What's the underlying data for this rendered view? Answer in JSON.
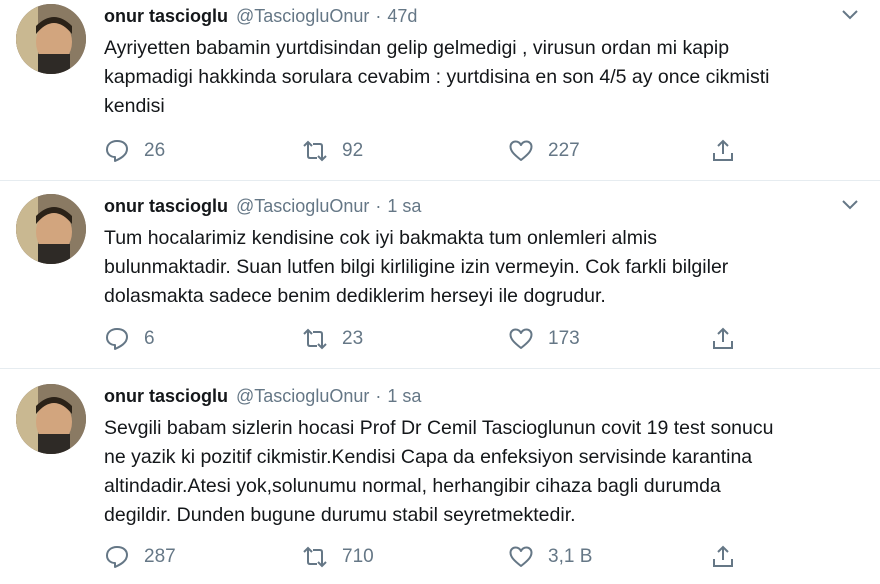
{
  "tweets": [
    {
      "name": "onur tascioglu",
      "handle": "@TasciogluOnur",
      "separator": "·",
      "time": "47d",
      "lines": [
        "Ayriyetten babamin yurtdisindan gelip gelmedigi , virusun ordan mi kapip",
        "kapmadigi hakkinda sorulara cevabim : yurtdisina en son 4/5 ay once cikmisti",
        "kendisi"
      ],
      "replies": "26",
      "retweets": "92",
      "likes": "227"
    },
    {
      "name": "onur tascioglu",
      "handle": "@TasciogluOnur",
      "separator": "·",
      "time": "1 sa",
      "lines": [
        "Tum hocalarimiz kendisine cok iyi bakmakta tum onlemleri almis",
        "bulunmaktadir. Suan lutfen bilgi kirliligine izin vermeyin. Cok farkli bilgiler",
        "dolasmakta sadece benim dediklerim herseyi ile dogrudur."
      ],
      "replies": "6",
      "retweets": "23",
      "likes": "173"
    },
    {
      "name": "onur tascioglu",
      "handle": "@TasciogluOnur",
      "separator": "·",
      "time": "1 sa",
      "lines": [
        "Sevgili babam sizlerin hocasi Prof Dr Cemil Tascioglunun covit 19 test sonucu",
        "ne yazik ki pozitif cikmistir.Kendisi Capa da enfeksiyon servisinde karantina",
        "altindadir.Atesi yok,solunumu normal, herhangibir cihaza bagli durumda",
        "degildir. Dunden bugune durumu stabil seyretmektedir."
      ],
      "replies": "287",
      "retweets": "710",
      "likes": "3,1 B"
    }
  ],
  "icons": {
    "reply": "reply-icon",
    "retweet": "retweet-icon",
    "like": "heart-icon",
    "share": "share-icon",
    "caret": "chevron-down-icon"
  },
  "colors": {
    "text": "#14171a",
    "secondary": "#657786",
    "divider": "#e6ecf0"
  }
}
